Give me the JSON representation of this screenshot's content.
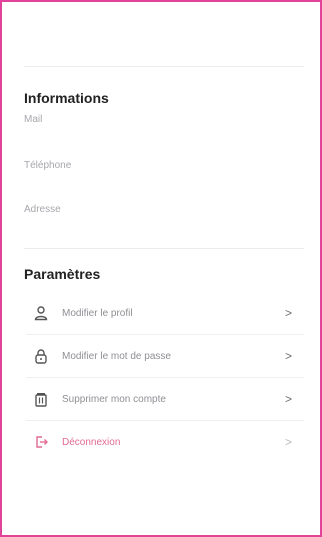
{
  "sections": {
    "informations_title": "Informations",
    "parametres_title": "Paramètres"
  },
  "info": {
    "mail_label": "Mail",
    "phone_label": "Téléphone",
    "address_label": "Adresse"
  },
  "menu": {
    "items": [
      {
        "label": "Modifier le profil",
        "icon": "user-icon"
      },
      {
        "label": "Modifier le mot de passe",
        "icon": "lock-icon"
      },
      {
        "label": "Supprimer mon compte",
        "icon": "trash-icon"
      },
      {
        "label": "Déconnexion",
        "icon": "logout-icon"
      }
    ]
  },
  "colors": {
    "frame_border": "#e1439a",
    "logout_accent": "#e06a93"
  }
}
